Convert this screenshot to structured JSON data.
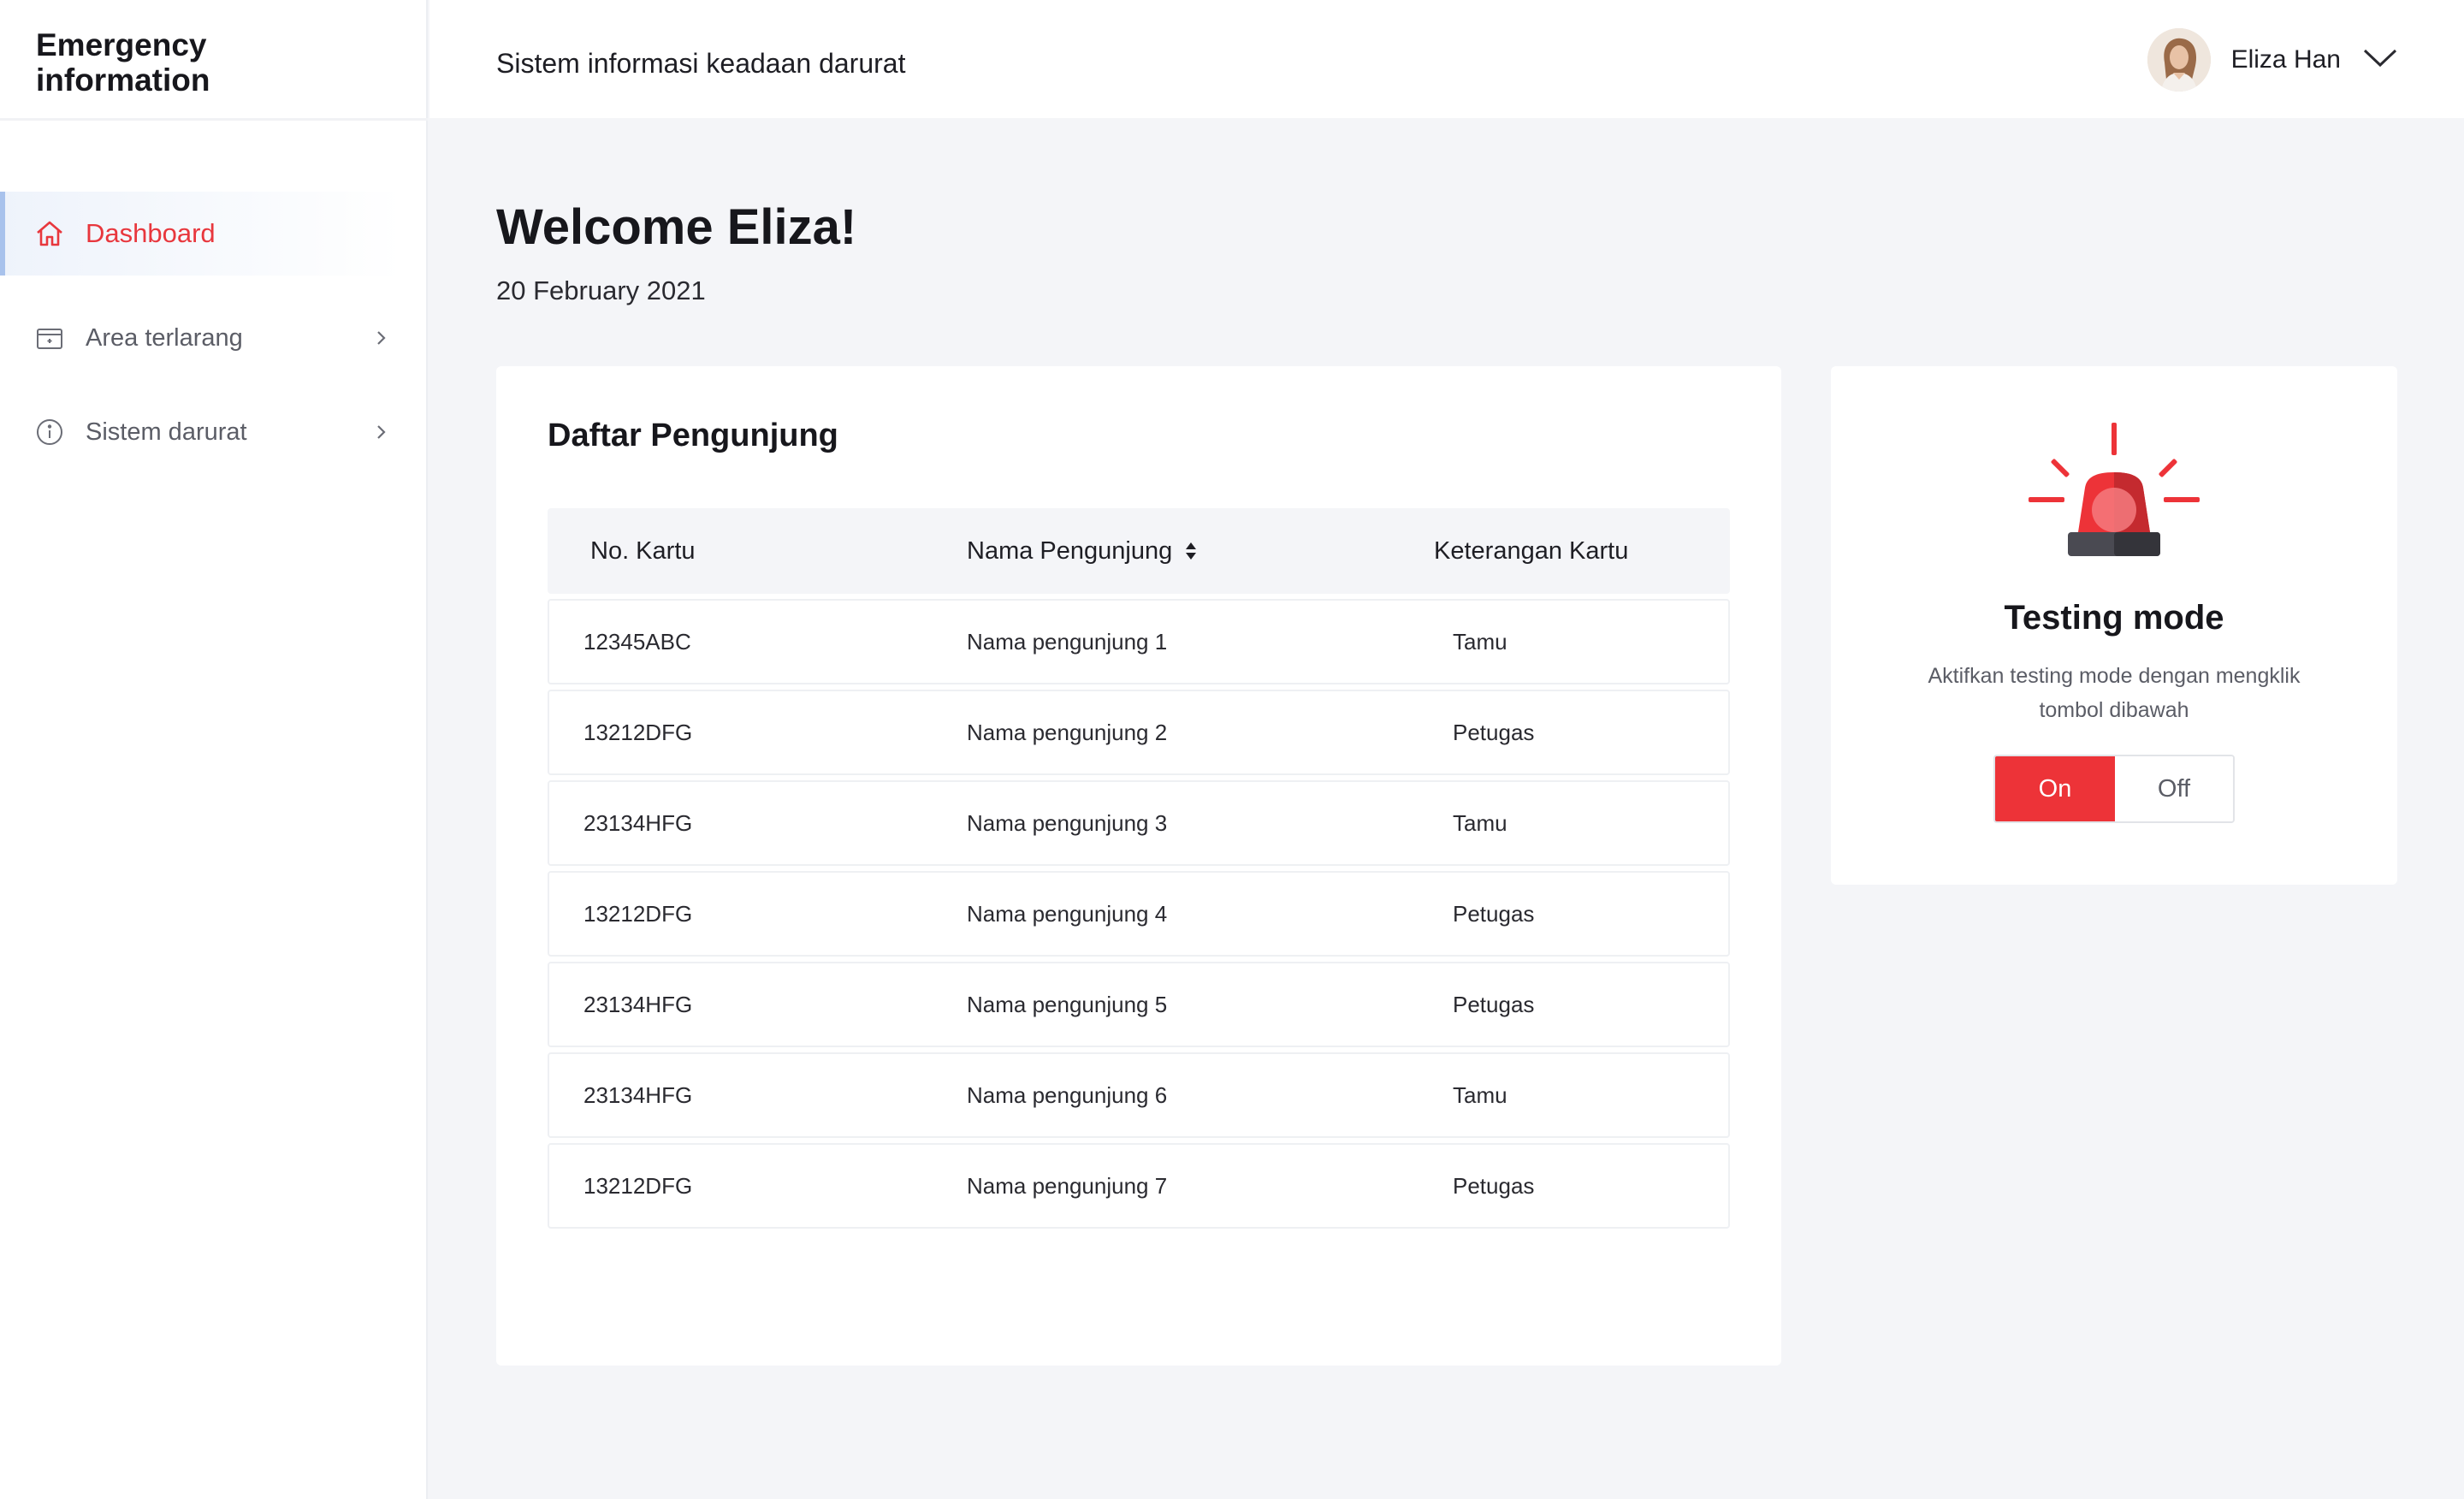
{
  "sidebar": {
    "brand": "Emergency information",
    "items": [
      {
        "label": "Dashboard",
        "icon": "home-icon",
        "active": true
      },
      {
        "label": "Area terlarang",
        "icon": "restricted-area-icon",
        "active": false
      },
      {
        "label": "Sistem darurat",
        "icon": "info-icon",
        "active": false
      }
    ]
  },
  "header": {
    "title": "Sistem informasi keadaan darurat",
    "user_name": "Eliza Han"
  },
  "main": {
    "welcome": "Welcome Eliza!",
    "date": "20 February 2021"
  },
  "visitors": {
    "title": "Daftar Pengunjung",
    "columns": [
      "No. Kartu",
      "Nama Pengunjung",
      "Keterangan Kartu"
    ],
    "rows": [
      [
        "12345ABC",
        "Nama pengunjung 1",
        "Tamu"
      ],
      [
        "13212DFG",
        "Nama pengunjung 2",
        "Petugas"
      ],
      [
        "23134HFG",
        "Nama pengunjung 3",
        "Tamu"
      ],
      [
        "13212DFG",
        "Nama pengunjung 4",
        "Petugas"
      ],
      [
        "23134HFG",
        "Nama pengunjung 5",
        "Petugas"
      ],
      [
        "23134HFG",
        "Nama pengunjung 6",
        "Tamu"
      ],
      [
        "13212DFG",
        "Nama pengunjung 7",
        "Petugas"
      ]
    ]
  },
  "testing": {
    "title": "Testing mode",
    "description": "Aktifkan testing mode dengan mengklik tombol dibawah",
    "on_label": "On",
    "off_label": "Off",
    "state": "on"
  },
  "colors": {
    "accent": "#ed3338",
    "active_nav_border": "#a8c2ec",
    "background": "#f4f5f8"
  }
}
